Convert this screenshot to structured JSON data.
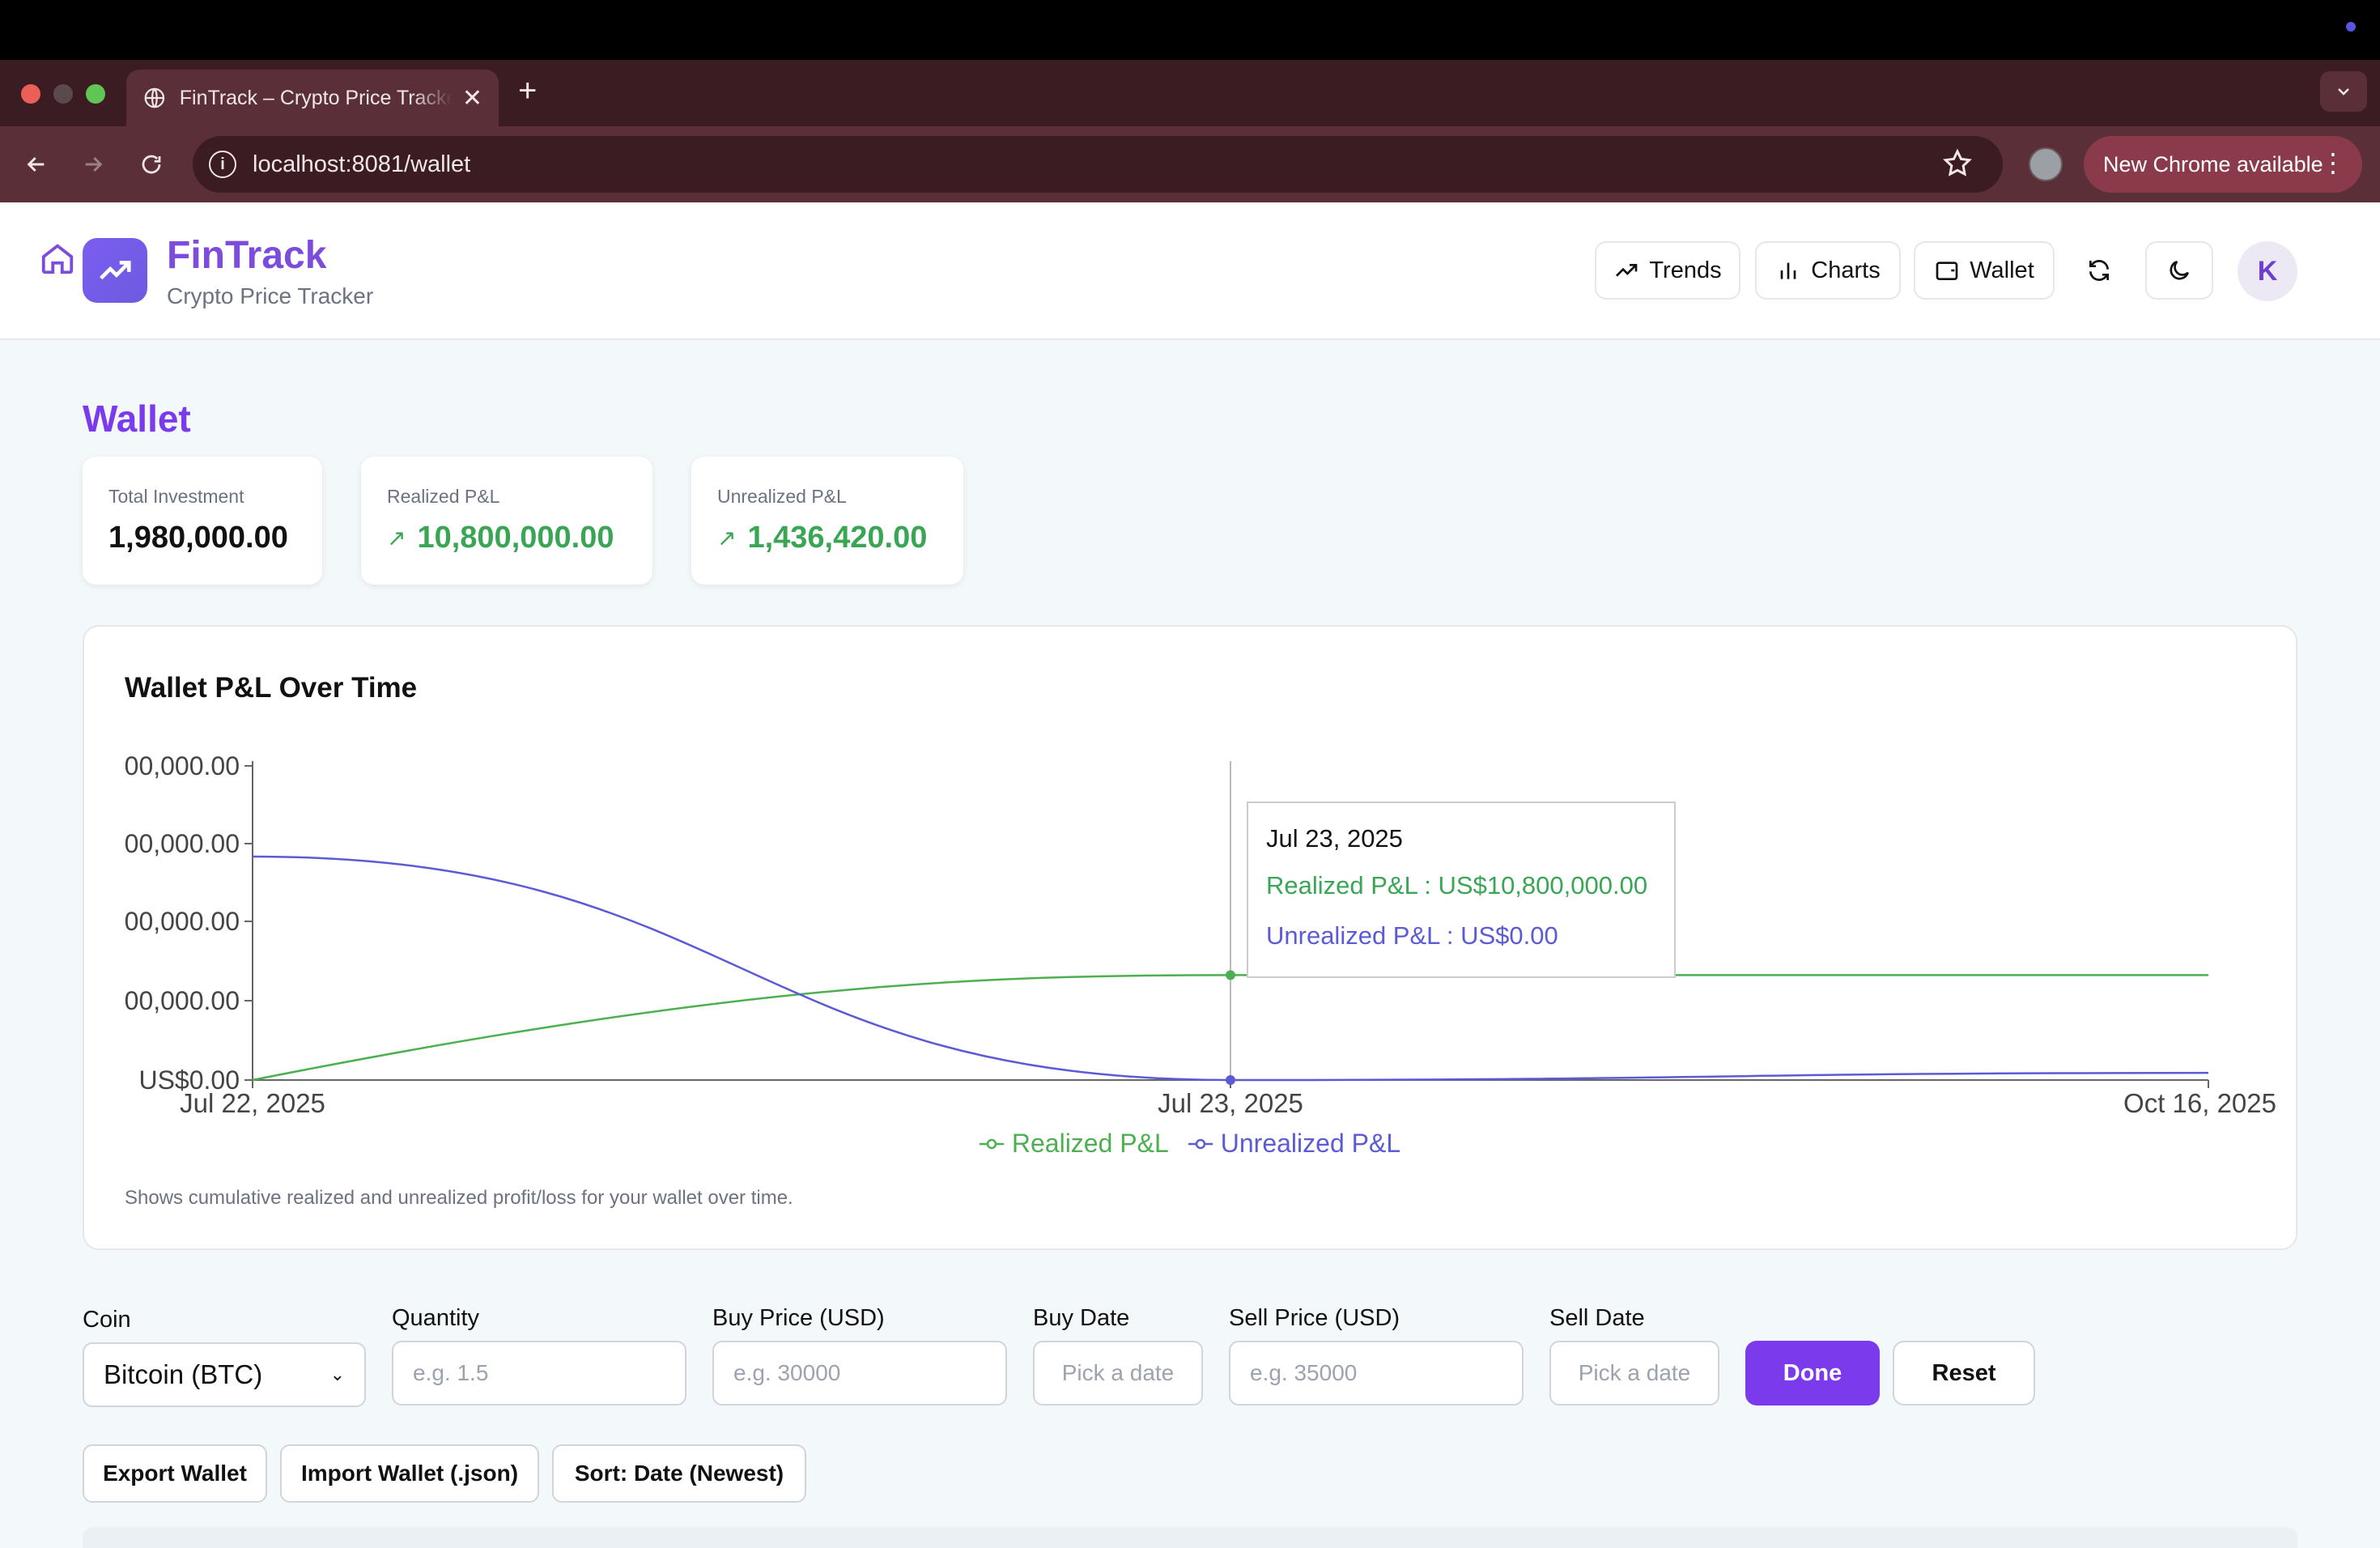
{
  "browser": {
    "tab_title": "FinTrack – Crypto Price Tracker",
    "new_tab_symbol": "+",
    "close_symbol": "✕",
    "url": "localhost:8081/wallet",
    "update_pill": "New Chrome available"
  },
  "header": {
    "brand": "FinTrack",
    "subtitle": "Crypto Price Tracker",
    "nav": {
      "trends": "Trends",
      "charts": "Charts",
      "wallet": "Wallet"
    },
    "avatar_initial": "K"
  },
  "page": {
    "title": "Wallet",
    "stats": [
      {
        "label": "Total Investment",
        "value": "1,980,000.00"
      },
      {
        "label": "Realized P&L",
        "value": "10,800,000.00",
        "trend": "up"
      },
      {
        "label": "Unrealized P&L",
        "value": "1,436,420.00",
        "trend": "up"
      }
    ]
  },
  "chart": {
    "title": "Wallet P&L Over Time",
    "caption": "Shows cumulative realized and unrealized profit/loss for your wallet over time.",
    "tooltip": {
      "date": "Jul 23, 2025",
      "realized": "Realized P&L : US$10,800,000.00",
      "unrealized": "Unrealized P&L : US$0.00"
    },
    "legend": {
      "realized": "Realized P&L",
      "unrealized": "Unrealized P&L"
    },
    "colors": {
      "realized": "#4caf50",
      "unrealized": "#5b5bd6"
    }
  },
  "chart_data": {
    "type": "line",
    "title": "Wallet P&L Over Time",
    "x": [
      "Jul 22, 2025",
      "Jul 23, 2025",
      "Oct 16, 2025"
    ],
    "y_tick_labels": [
      "US$0.00",
      "00,000.00",
      "00,000.00",
      "00,000.00",
      "00,000.00"
    ],
    "ylim": [
      0,
      32000000
    ],
    "series": [
      {
        "name": "Realized P&L",
        "values": [
          0,
          10800000,
          10800000
        ]
      },
      {
        "name": "Unrealized P&L",
        "values": [
          23000000,
          0,
          736000
        ]
      }
    ],
    "legend": "bottom-center",
    "grid": false
  },
  "form": {
    "coin_label": "Coin",
    "coin_value": "Bitcoin (BTC)",
    "quantity_label": "Quantity",
    "quantity_placeholder": "e.g. 1.5",
    "buy_price_label": "Buy Price (USD)",
    "buy_price_placeholder": "e.g. 30000",
    "buy_date_label": "Buy Date",
    "buy_date_placeholder": "Pick a date",
    "sell_price_label": "Sell Price (USD)",
    "sell_price_placeholder": "e.g. 35000",
    "sell_date_label": "Sell Date",
    "sell_date_placeholder": "Pick a date",
    "done": "Done",
    "reset": "Reset"
  },
  "actions": {
    "export": "Export Wallet",
    "import": "Import Wallet (.json)",
    "sort": "Sort: Date (Newest)"
  }
}
